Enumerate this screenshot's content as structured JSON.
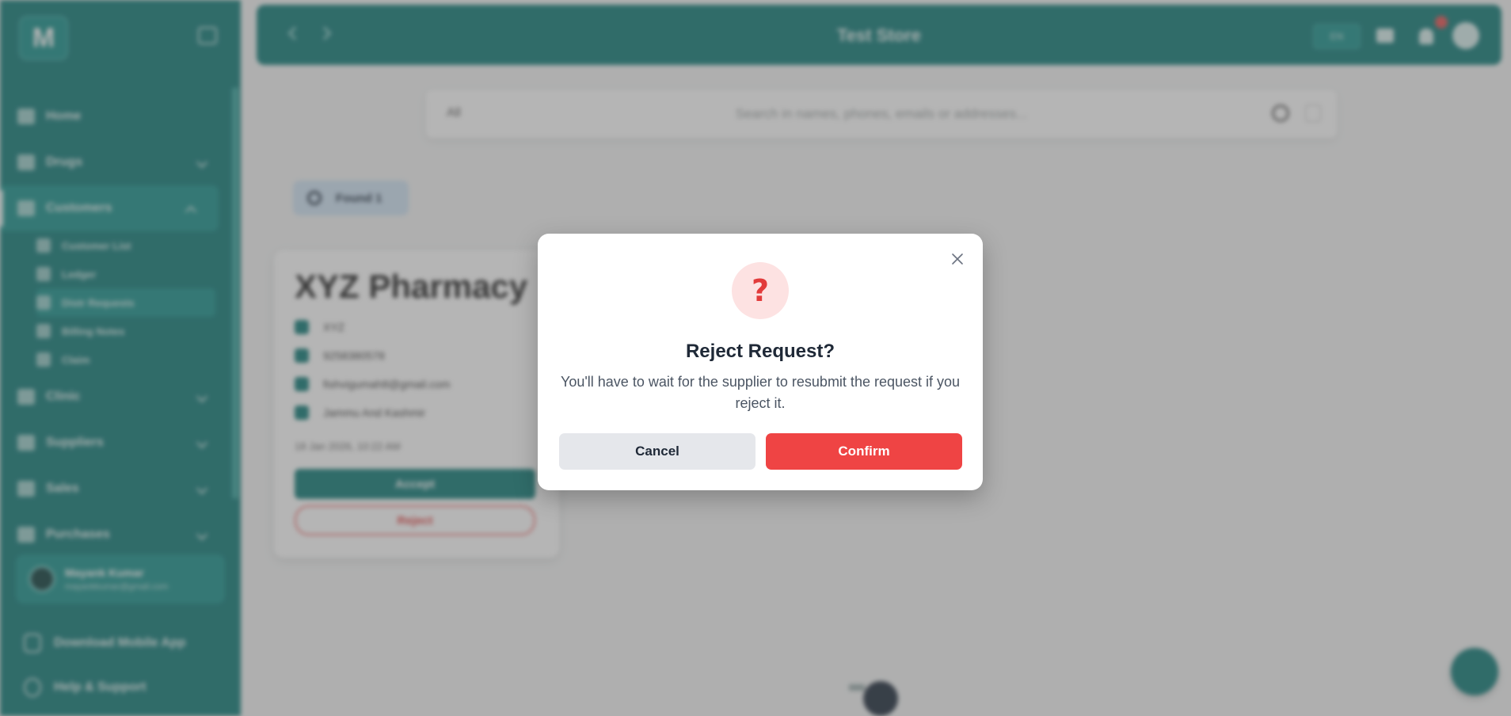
{
  "sidebar": {
    "logo": "M",
    "items": [
      {
        "label": "Home"
      },
      {
        "label": "Drugs"
      },
      {
        "label": "Customers"
      },
      {
        "label": "Clinic"
      },
      {
        "label": "Suppliers"
      },
      {
        "label": "Sales"
      },
      {
        "label": "Purchases"
      }
    ],
    "sub_items": [
      {
        "label": "Customer List"
      },
      {
        "label": "Ledger"
      },
      {
        "label": "Distr Requests"
      },
      {
        "label": "Billing Notes"
      },
      {
        "label": "Claim"
      }
    ],
    "user": {
      "name": "Mayank Kumar",
      "email": "mayankkumar@gmail.com"
    },
    "download_app": "Download Mobile App",
    "help": "Help & Support"
  },
  "topbar": {
    "title": "Test Store",
    "language": "EN"
  },
  "search": {
    "scope": "All",
    "placeholder": "Search in names, phones, emails or addresses..."
  },
  "filter_chip": {
    "label": "Found 1"
  },
  "request_card": {
    "name": "XYZ Pharmacy",
    "contact": "XYZ",
    "phone": "9258380578",
    "email": "fishvigumah8@gmail.com",
    "address": "Jammu And Kashmir",
    "date": "18 Jan 2026, 10:22 AM",
    "accept_label": "Accept",
    "reject_label": "Reject"
  },
  "modal": {
    "icon_glyph": "?",
    "title": "Reject Request?",
    "message": "You'll have to wait for the supplier to resubmit the request if you reject it.",
    "cancel_label": "Cancel",
    "confirm_label": "Confirm"
  },
  "colors": {
    "brand": "#0e7a76",
    "danger": "#ef4444",
    "danger_soft": "#fde2e2",
    "neutral_button": "#e5e7eb"
  }
}
